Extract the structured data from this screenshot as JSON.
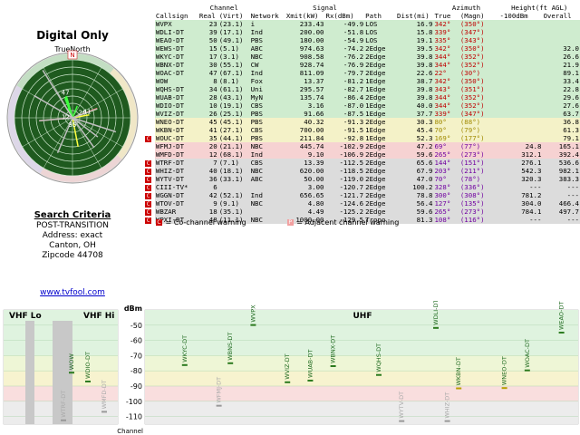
{
  "title": "Digital Only",
  "polar": {
    "north_label": "TrueNorth",
    "n_mark": "N",
    "labels": [
      {
        "text": "47",
        "angle": 343,
        "r": 0.42
      },
      {
        "text": "12",
        "angle": 260,
        "r": 0.12
      },
      {
        "text": "20",
        "angle": 72,
        "r": 0.18
      },
      {
        "text": "41",
        "angle": 75,
        "r": 0.26
      },
      {
        "text": "35",
        "angle": 180,
        "r": 0.16
      }
    ]
  },
  "search": {
    "heading": "Search Criteria",
    "line1": "POST-TRANSITION",
    "line2": "Address: exact",
    "line3": "Canton, OH",
    "line4": "Zipcode 44708"
  },
  "weblink": "www.tvfool.com",
  "table": {
    "group_headers": {
      "channel": "Channel",
      "signal": "Signal",
      "azimuth": "Azimuth",
      "height": "Height(ft AGL)"
    },
    "headers": [
      "Callsign",
      "Real",
      "(Virt)",
      "Network",
      "Xmit(kW)",
      "Rx(dBm)",
      "Path",
      "Dist(mi)",
      "True",
      "(Magn)",
      "-100dBm",
      "Overall"
    ],
    "rows": [
      {
        "mark": "",
        "cs": "WVPX",
        "real": "23",
        "virt": "(23.1)",
        "net": "i",
        "xmit": "233.43",
        "rx": "-49.9",
        "path": "LOS",
        "dist": "16.9",
        "true": "342°",
        "magn": "(350°)",
        "h100": "",
        "hall": "",
        "color": "g"
      },
      {
        "mark": "",
        "cs": "WDLI-DT",
        "real": "39",
        "virt": "(17.1)",
        "net": "Ind",
        "xmit": "200.00",
        "rx": "-51.8",
        "path": "LOS",
        "dist": "15.8",
        "true": "339°",
        "magn": "(347°)",
        "h100": "",
        "hall": "",
        "color": "g"
      },
      {
        "mark": "",
        "cs": "WEAO-DT",
        "real": "50",
        "virt": "(49.1)",
        "net": "PBS",
        "xmit": "180.00",
        "rx": "-54.9",
        "path": "LOS",
        "dist": "19.1",
        "true": "335°",
        "magn": "(343°)",
        "h100": "",
        "hall": "",
        "color": "g"
      },
      {
        "mark": "",
        "cs": "WEWS-DT",
        "real": "15",
        "virt": "(5.1)",
        "net": "ABC",
        "xmit": "974.63",
        "rx": "-74.2",
        "path": "2Edge",
        "dist": "39.5",
        "true": "342°",
        "magn": "(350°)",
        "h100": "",
        "hall": "32.0",
        "color": "g"
      },
      {
        "mark": "",
        "cs": "WKYC-DT",
        "real": "17",
        "virt": "(3.1)",
        "net": "NBC",
        "xmit": "908.58",
        "rx": "-76.2",
        "path": "2Edge",
        "dist": "39.8",
        "true": "344°",
        "magn": "(352°)",
        "h100": "",
        "hall": "26.6",
        "color": "g"
      },
      {
        "mark": "",
        "cs": "WBNX-DT",
        "real": "30",
        "virt": "(55.1)",
        "net": "CW",
        "xmit": "928.74",
        "rx": "-76.9",
        "path": "2Edge",
        "dist": "39.8",
        "true": "344°",
        "magn": "(352°)",
        "h100": "",
        "hall": "21.9",
        "color": "g"
      },
      {
        "mark": "",
        "cs": "WOAC-DT",
        "real": "47",
        "virt": "(67.1)",
        "net": "Ind",
        "xmit": "811.09",
        "rx": "-79.7",
        "path": "2Edge",
        "dist": "22.6",
        "true": "22°",
        "magn": "(30°)",
        "h100": "",
        "hall": "89.1",
        "color": "g"
      },
      {
        "mark": "",
        "cs": "WOW",
        "real": "8",
        "virt": "(8.1)",
        "net": "Fox",
        "xmit": "13.37",
        "rx": "-81.2",
        "path": "1Edge",
        "dist": "38.7",
        "true": "342°",
        "magn": "(350°)",
        "h100": "",
        "hall": "33.4",
        "color": "g"
      },
      {
        "mark": "",
        "cs": "WQHS-DT",
        "real": "34",
        "virt": "(61.1)",
        "net": "Uni",
        "xmit": "295.57",
        "rx": "-82.7",
        "path": "1Edge",
        "dist": "39.8",
        "true": "343°",
        "magn": "(351°)",
        "h100": "",
        "hall": "22.8",
        "color": "g"
      },
      {
        "mark": "",
        "cs": "WUAB-DT",
        "real": "28",
        "virt": "(43.1)",
        "net": "MyN",
        "xmit": "135.74",
        "rx": "-86.4",
        "path": "2Edge",
        "dist": "39.8",
        "true": "344°",
        "magn": "(352°)",
        "h100": "",
        "hall": "29.6",
        "color": "g"
      },
      {
        "mark": "",
        "cs": "WDIO-DT",
        "real": "10",
        "virt": "(19.1)",
        "net": "CBS",
        "xmit": "3.16",
        "rx": "-87.0",
        "path": "1Edge",
        "dist": "40.0",
        "true": "344°",
        "magn": "(352°)",
        "h100": "",
        "hall": "27.6",
        "color": "g"
      },
      {
        "mark": "",
        "cs": "WVIZ-DT",
        "real": "26",
        "virt": "(25.1)",
        "net": "PBS",
        "xmit": "91.66",
        "rx": "-87.5",
        "path": "1Edge",
        "dist": "37.7",
        "true": "339°",
        "magn": "(347°)",
        "h100": "",
        "hall": "63.7",
        "color": "g"
      },
      {
        "mark": "",
        "cs": "WNEO-DT",
        "real": "45",
        "virt": "(45.1)",
        "net": "PBS",
        "xmit": "40.32",
        "rx": "-91.3",
        "path": "2Edge",
        "dist": "30.3",
        "true": "80°",
        "magn": "(88°)",
        "h100": "",
        "hall": "36.8",
        "color": "y"
      },
      {
        "mark": "",
        "cs": "WKBN-DT",
        "real": "41",
        "virt": "(27.1)",
        "net": "CBS",
        "xmit": "700.00",
        "rx": "-91.5",
        "path": "1Edge",
        "dist": "45.4",
        "true": "70°",
        "magn": "(79°)",
        "h100": "",
        "hall": "61.3",
        "color": "y"
      },
      {
        "mark": "C",
        "cs": "WOUC-DT",
        "real": "35",
        "virt": "(44.1)",
        "net": "PBS",
        "xmit": "211.84",
        "rx": "-92.8",
        "path": "1Edge",
        "dist": "52.3",
        "true": "169°",
        "magn": "(177°)",
        "h100": "",
        "hall": "79.1",
        "color": "y"
      },
      {
        "mark": "",
        "cs": "WFMJ-DT",
        "real": "20",
        "virt": "(21.1)",
        "net": "NBC",
        "xmit": "445.74",
        "rx": "-102.9",
        "path": "2Edge",
        "dist": "47.2",
        "true": "69°",
        "magn": "(77°)",
        "h100": "24.8",
        "hall": "165.1",
        "color": "r"
      },
      {
        "mark": "",
        "cs": "WMFD-DT",
        "real": "12",
        "virt": "(68.1)",
        "net": "Ind",
        "xmit": "9.10",
        "rx": "-106.9",
        "path": "2Edge",
        "dist": "59.6",
        "true": "265°",
        "magn": "(273°)",
        "h100": "312.1",
        "hall": "392.4",
        "color": "r"
      },
      {
        "mark": "C",
        "cs": "WTRF-DT",
        "real": "7",
        "virt": "(7.1)",
        "net": "CBS",
        "xmit": "13.39",
        "rx": "-112.5",
        "path": "2Edge",
        "dist": "65.6",
        "true": "144°",
        "magn": "(151°)",
        "h100": "276.1",
        "hall": "536.6",
        "color": "s"
      },
      {
        "mark": "C",
        "cs": "WHIZ-DT",
        "real": "40",
        "virt": "(18.1)",
        "net": "NBC",
        "xmit": "620.00",
        "rx": "-118.5",
        "path": "2Edge",
        "dist": "67.9",
        "true": "203°",
        "magn": "(211°)",
        "h100": "542.3",
        "hall": "982.1",
        "color": "s"
      },
      {
        "mark": "C",
        "cs": "WYTV-DT",
        "real": "36",
        "virt": "(33.1)",
        "net": "ABC",
        "xmit": "50.00",
        "rx": "-119.0",
        "path": "2Edge",
        "dist": "47.0",
        "true": "70°",
        "magn": "(78°)",
        "h100": "320.3",
        "hall": "383.3",
        "color": "s"
      },
      {
        "mark": "C",
        "cs": "CIII-TV*",
        "real": "6",
        "virt": "",
        "net": "",
        "xmit": "3.00",
        "rx": "-120.7",
        "path": "2Edge",
        "dist": "100.2",
        "true": "328°",
        "magn": "(336°)",
        "h100": "---",
        "hall": "---",
        "color": "s"
      },
      {
        "mark": "C",
        "cs": "WGGN-DT",
        "real": "42",
        "virt": "(52.1)",
        "net": "Ind",
        "xmit": "656.65",
        "rx": "-121.7",
        "path": "2Edge",
        "dist": "78.8",
        "true": "300°",
        "magn": "(308°)",
        "h100": "781.2",
        "hall": "---",
        "color": "s"
      },
      {
        "mark": "C",
        "cs": "WTOV-DT",
        "real": "9",
        "virt": "(9.1)",
        "net": "NBC",
        "xmit": "4.80",
        "rx": "-124.6",
        "path": "2Edge",
        "dist": "56.4",
        "true": "127°",
        "magn": "(135°)",
        "h100": "304.0",
        "hall": "466.4",
        "color": "s"
      },
      {
        "mark": "C",
        "cs": "WBZAR",
        "real": "18",
        "virt": "(35.1)",
        "net": "",
        "xmit": "4.49",
        "rx": "-125.2",
        "path": "2Edge",
        "dist": "59.6",
        "true": "265°",
        "magn": "(273°)",
        "h100": "784.1",
        "hall": "497.7",
        "color": "s"
      },
      {
        "mark": "C",
        "cs": "WPXI-DT",
        "real": "48",
        "virt": "(11.1)",
        "net": "NBC",
        "xmit": "1000.00",
        "rx": "-129.5",
        "path": "Tropo",
        "dist": "81.3",
        "true": "108°",
        "magn": "(116°)",
        "h100": "---",
        "hall": "---",
        "color": "s"
      }
    ]
  },
  "legend": {
    "co_mark": "C",
    "co": "= Co-channel warning",
    "adj_mark": "P",
    "adj": "= Adjacent channel warning"
  },
  "spectrum": {
    "vhf_lo": "VHF Lo",
    "vhf_hi": "VHF Hi",
    "uhf": "UHF",
    "dbm_label": "dBm",
    "channel_label": "Channel",
    "y_ticks": [
      -50,
      -60,
      -70,
      -80,
      -90,
      -100,
      -110
    ],
    "stations": [
      {
        "cs": "WBNS-DT",
        "ch": 21,
        "dbm": -75
      },
      {
        "cs": "WKYC-DT",
        "ch": 17,
        "dbm": -76.2
      },
      {
        "cs": "WFMJ-DT",
        "ch": 20,
        "dbm": -102.9
      },
      {
        "cs": "WVPX",
        "ch": 23,
        "dbm": -49.9
      },
      {
        "cs": "WVIZ-DT",
        "ch": 26,
        "dbm": -87.5
      },
      {
        "cs": "WUAB-DT",
        "ch": 28,
        "dbm": -86.4
      },
      {
        "cs": "WBNX-DT",
        "ch": 30,
        "dbm": -76.9
      },
      {
        "cs": "WQHS-DT",
        "ch": 34,
        "dbm": -82.7
      },
      {
        "cs": "WYTV-DT",
        "ch": 36,
        "dbm": -119.0
      },
      {
        "cs": "WDLI-DT",
        "ch": 39,
        "dbm": -51.8
      },
      {
        "cs": "WHIZ-DT",
        "ch": 40,
        "dbm": -118.5
      },
      {
        "cs": "WKBN-DT",
        "ch": 41,
        "dbm": -91.5
      },
      {
        "cs": "WNEO-DT",
        "ch": 45,
        "dbm": -91.3
      },
      {
        "cs": "WOAC-DT",
        "ch": 47,
        "dbm": -79.7
      },
      {
        "cs": "WEAO-DT",
        "ch": 50,
        "dbm": -54.9
      },
      {
        "cs": "WTRF-DT",
        "ch": 7,
        "dbm": -112.5
      },
      {
        "cs": "WOW",
        "ch": 8,
        "dbm": -81.2
      },
      {
        "cs": "WDIO-DT",
        "ch": 10,
        "dbm": -87.0
      },
      {
        "cs": "WMFD-DT",
        "ch": 12,
        "dbm": -106.9
      }
    ]
  },
  "colors": {
    "green": "#3a8a2a",
    "yellow": "#c8b400",
    "red": "#c00000",
    "gray": "#999999",
    "label": "#006600"
  }
}
